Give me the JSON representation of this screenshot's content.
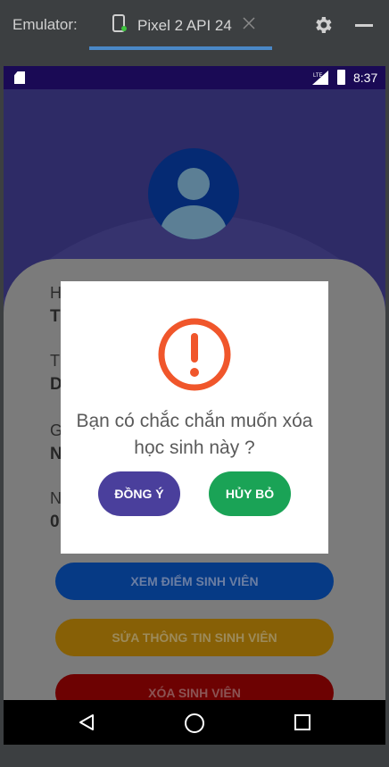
{
  "emulator": {
    "title": "Emulator:",
    "tab_label": "Pixel 2 API 24",
    "accent_color": "#4a88c7"
  },
  "status_bar": {
    "time": "8:37",
    "network": "LTE"
  },
  "profile": {
    "fields": [
      {
        "label": "H",
        "value": "T"
      },
      {
        "label": "T",
        "value": "D"
      },
      {
        "label": "G",
        "value": "N"
      },
      {
        "label": "N",
        "value": "0"
      }
    ]
  },
  "actions": {
    "view_scores": "XEM ĐIỂM SINH VIÊN",
    "edit_info": "SỬA THÔNG TIN SINH VIÊN",
    "delete_student": "XÓA SINH VIÊN"
  },
  "dialog": {
    "message": "Bạn có chắc chắn muốn xóa học sinh này ?",
    "confirm_label": "ĐỒNG Ý",
    "cancel_label": "HỦY BỎ",
    "icon": "alert-circle-icon",
    "icon_color": "#f0562b",
    "confirm_color": "#4a3f9c",
    "cancel_color": "#1aa356"
  }
}
